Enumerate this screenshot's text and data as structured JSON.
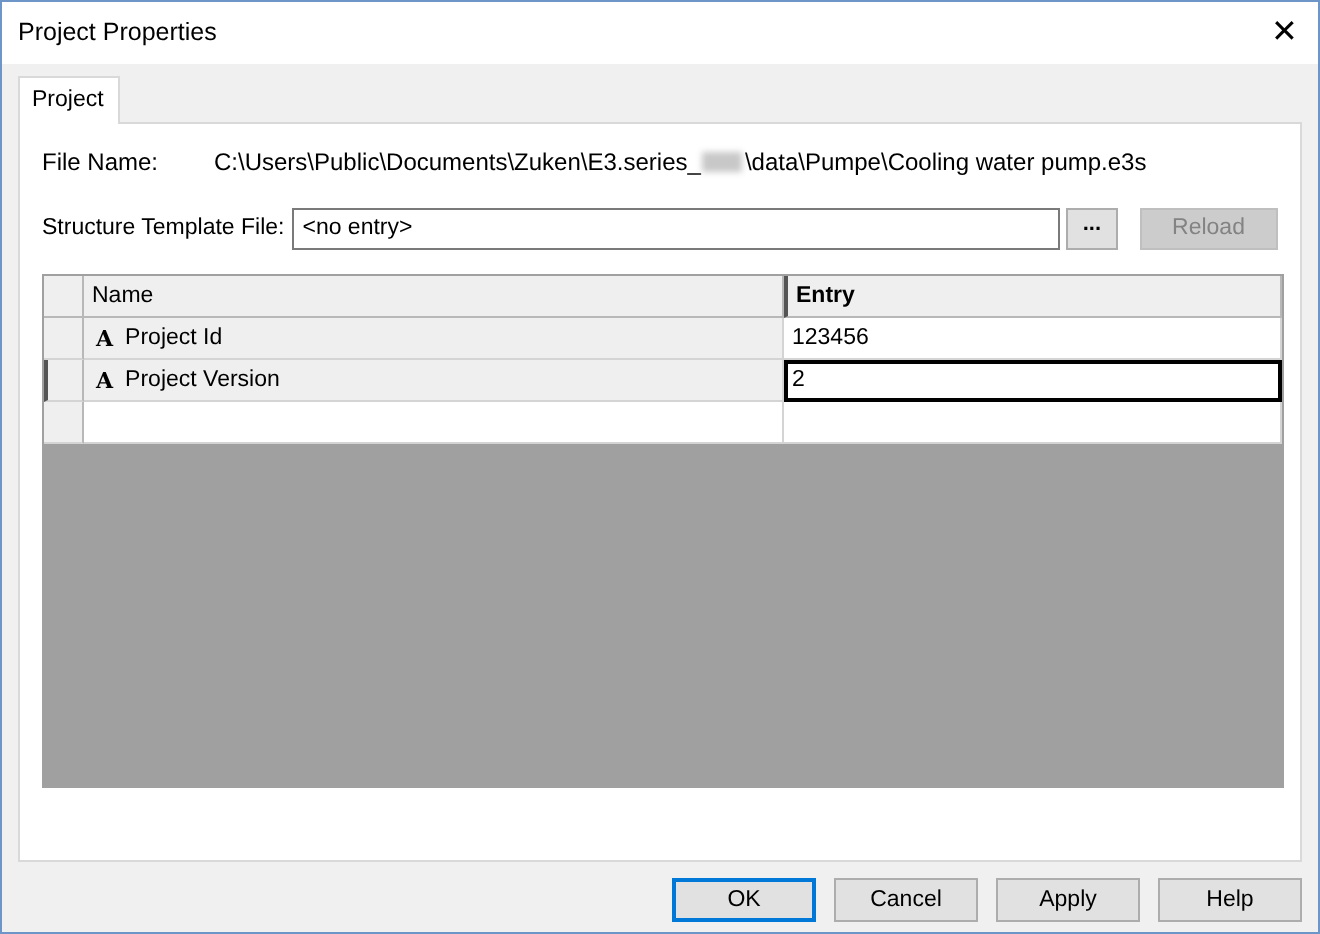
{
  "window": {
    "title": "Project Properties",
    "close": "✕"
  },
  "tabs": [
    {
      "label": "Project",
      "selected": true
    }
  ],
  "file_name": {
    "label": "File Name:",
    "path_start": "C:\\Users\\Public\\Documents\\Zuken\\E3.series_",
    "path_end": "\\data\\Pumpe\\Cooling water pump.e3s"
  },
  "structure_template": {
    "label": "Structure Template File:",
    "value": "<no entry>",
    "browse": "...",
    "reload": {
      "label": "Reload",
      "disabled": true
    }
  },
  "table": {
    "columns": [
      "Name",
      "Entry"
    ],
    "rows": [
      {
        "kind": "attribute",
        "icon": "A",
        "name": "Project Id",
        "entry": "123456",
        "selected": false
      },
      {
        "kind": "attribute",
        "icon": "A",
        "name": "Project Version",
        "entry": "2",
        "selected": true
      },
      {
        "kind": "new",
        "selected": false
      }
    ]
  },
  "buttons": [
    {
      "label": "OK",
      "default": true
    },
    {
      "label": "Cancel",
      "default": false
    },
    {
      "label": "Apply",
      "default": false
    },
    {
      "label": "Help",
      "default": false
    }
  ]
}
